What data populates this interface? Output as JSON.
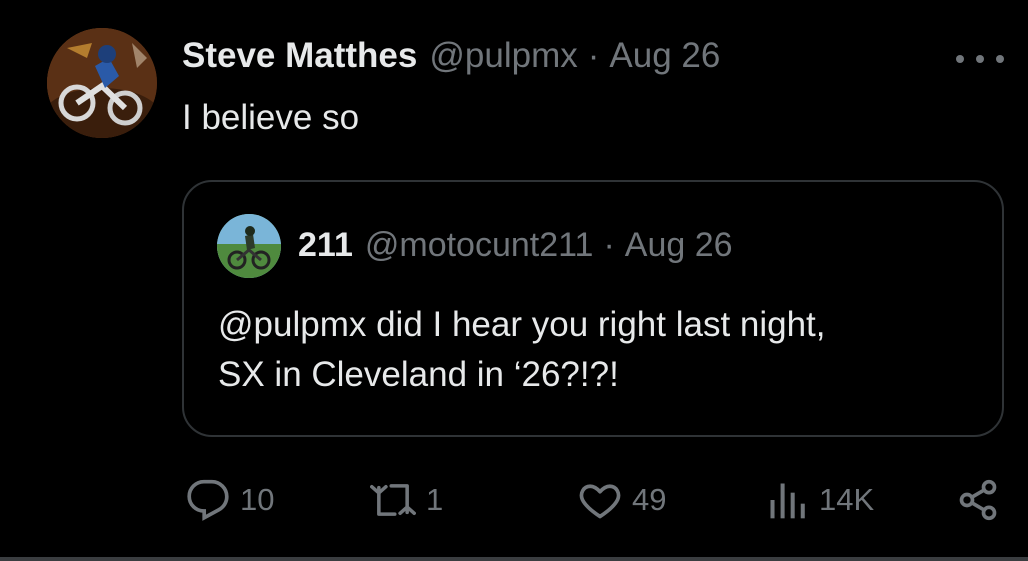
{
  "tweet": {
    "display_name": "Steve Matthes",
    "handle": "@pulpmx",
    "separator": "·",
    "date": "Aug 26",
    "text": "I believe so",
    "avatar_icon": "user-avatar"
  },
  "quoted_tweet": {
    "display_name": "211",
    "handle": "@motocunt211",
    "separator": "·",
    "date": "Aug 26",
    "text_line1": "@pulpmx did I hear you right last night,",
    "text_line2": "SX in Cleveland in ‘26?!?!",
    "avatar_icon": "user-avatar"
  },
  "actions": {
    "replies": "10",
    "retweets": "1",
    "likes": "49",
    "views": "14K"
  },
  "icons": {
    "more": "more-horizontal-icon",
    "reply": "reply-icon",
    "retweet": "retweet-icon",
    "like": "heart-icon",
    "views": "analytics-icon",
    "share": "share-icon"
  },
  "colors": {
    "background": "#000000",
    "primary_text": "#e7e9ea",
    "secondary_text": "#71767b",
    "border": "#2f3336"
  }
}
